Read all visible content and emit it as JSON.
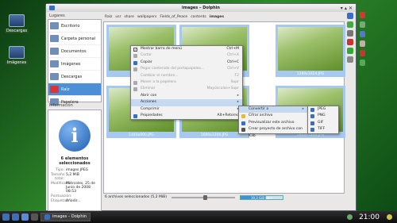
{
  "desktop": {
    "icons": [
      {
        "label": "Descargas"
      },
      {
        "label": "Imágenes"
      }
    ]
  },
  "window": {
    "title": "images – Dolphin"
  },
  "places": {
    "header": "Lugares",
    "items": [
      {
        "label": "Escritorio"
      },
      {
        "label": "Carpeta personal"
      },
      {
        "label": "Documentos"
      },
      {
        "label": "Imágenes"
      },
      {
        "label": "Descargas"
      },
      {
        "label": "Raíz"
      },
      {
        "label": "Papelera"
      }
    ]
  },
  "info_panel": {
    "header": "Información",
    "title": "6 elementos seleccionados",
    "rows": [
      {
        "key": "Tipo:",
        "value": "images JPEG"
      },
      {
        "key": "Tamaño total:",
        "value": "5,2 MiB"
      },
      {
        "key": "Modificado:",
        "value": "Miércoles, 25 de Junio de 2008 08:53"
      },
      {
        "key": "Puntuación:",
        "value": ""
      },
      {
        "key": "Etiquetas:",
        "value": "Añadir..."
      }
    ]
  },
  "breadcrumb": [
    "Raíz",
    "usr",
    "share",
    "wallpapers",
    "Fields_of_Peace",
    "contents",
    "images"
  ],
  "thumbnails": [
    {
      "caption": ""
    },
    {
      "caption": ""
    },
    {
      "caption": "1280x1024.JPG"
    },
    {
      "caption": "1440x900.JPG"
    },
    {
      "caption": "1600x1200.JPG"
    },
    {
      "caption": "1920x1200.JPG"
    }
  ],
  "statusbar": {
    "text": "6 archivos seleccionados (5,2 MiB)",
    "free_space": "19,3 GiB libre",
    "free_fraction": 0.6
  },
  "context_menu": {
    "items": [
      {
        "label": "Mostrar barra de menú",
        "shortcut": "Ctrl+M",
        "state": "checked"
      },
      {
        "label": "Cortar",
        "shortcut": "Ctrl+X",
        "state": "disabled"
      },
      {
        "label": "Copiar",
        "shortcut": "Ctrl+C",
        "state": "normal"
      },
      {
        "label": "Pegar contenido del portapapeles...",
        "shortcut": "Ctrl+V",
        "state": "disabled"
      },
      {
        "label": "Cambiar el nombre...",
        "shortcut": "F2",
        "state": "disabled"
      },
      {
        "label": "Mover a la papelera",
        "shortcut": "Supr",
        "state": "disabled"
      },
      {
        "label": "Eliminar",
        "shortcut": "Mayúsculas+Supr",
        "state": "disabled"
      },
      {
        "label": "Abrir con",
        "shortcut": "",
        "state": "submenu"
      },
      {
        "label": "Acciones",
        "shortcut": "",
        "state": "submenu-highlight"
      },
      {
        "label": "Comprimir",
        "shortcut": "",
        "state": "submenu"
      },
      {
        "label": "Propiedades",
        "shortcut": "Alt+Retorno",
        "state": "normal"
      }
    ]
  },
  "actions_submenu": {
    "items": [
      {
        "label": "Convertir a",
        "state": "submenu-highlight"
      },
      {
        "label": "Cifrar archivo",
        "state": "normal"
      },
      {
        "label": "Previsualizar este archivo",
        "state": "normal"
      },
      {
        "label": "Crear proyecto de archivo con K3b",
        "state": "normal"
      }
    ]
  },
  "convert_submenu": {
    "items": [
      {
        "label": "JPEG"
      },
      {
        "label": "PNG"
      },
      {
        "label": "GIF"
      },
      {
        "label": "TIFF"
      }
    ]
  },
  "taskbar": {
    "task_label": "images – Dolphin",
    "clock": "21:00"
  }
}
